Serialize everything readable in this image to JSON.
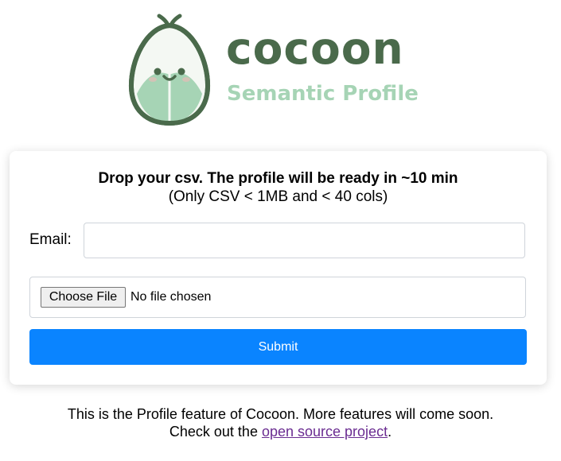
{
  "header": {
    "brand_name": "cocoon",
    "brand_subtitle": "Semantic Profile"
  },
  "upload_card": {
    "title": "Drop your csv. The profile will be ready in ~10 min",
    "subtitle": "(Only CSV < 1MB and < 40 cols)",
    "email_label": "Email:",
    "email_value": "",
    "file_button_label": "Choose File",
    "file_status": "No file chosen",
    "submit_label": "Submit"
  },
  "footer": {
    "line1": "This is the Profile feature of Cocoon. More features will come soon.",
    "line2_prefix": "Check out the ",
    "link_text": "open source project",
    "line2_suffix": "."
  },
  "colors": {
    "brand_dark": "#4a6a4b",
    "brand_light": "#a6d4b5",
    "primary_button": "#0a84ff",
    "link": "#6a2c91"
  },
  "icons": {
    "logo": "cocoon-sprout-icon"
  }
}
